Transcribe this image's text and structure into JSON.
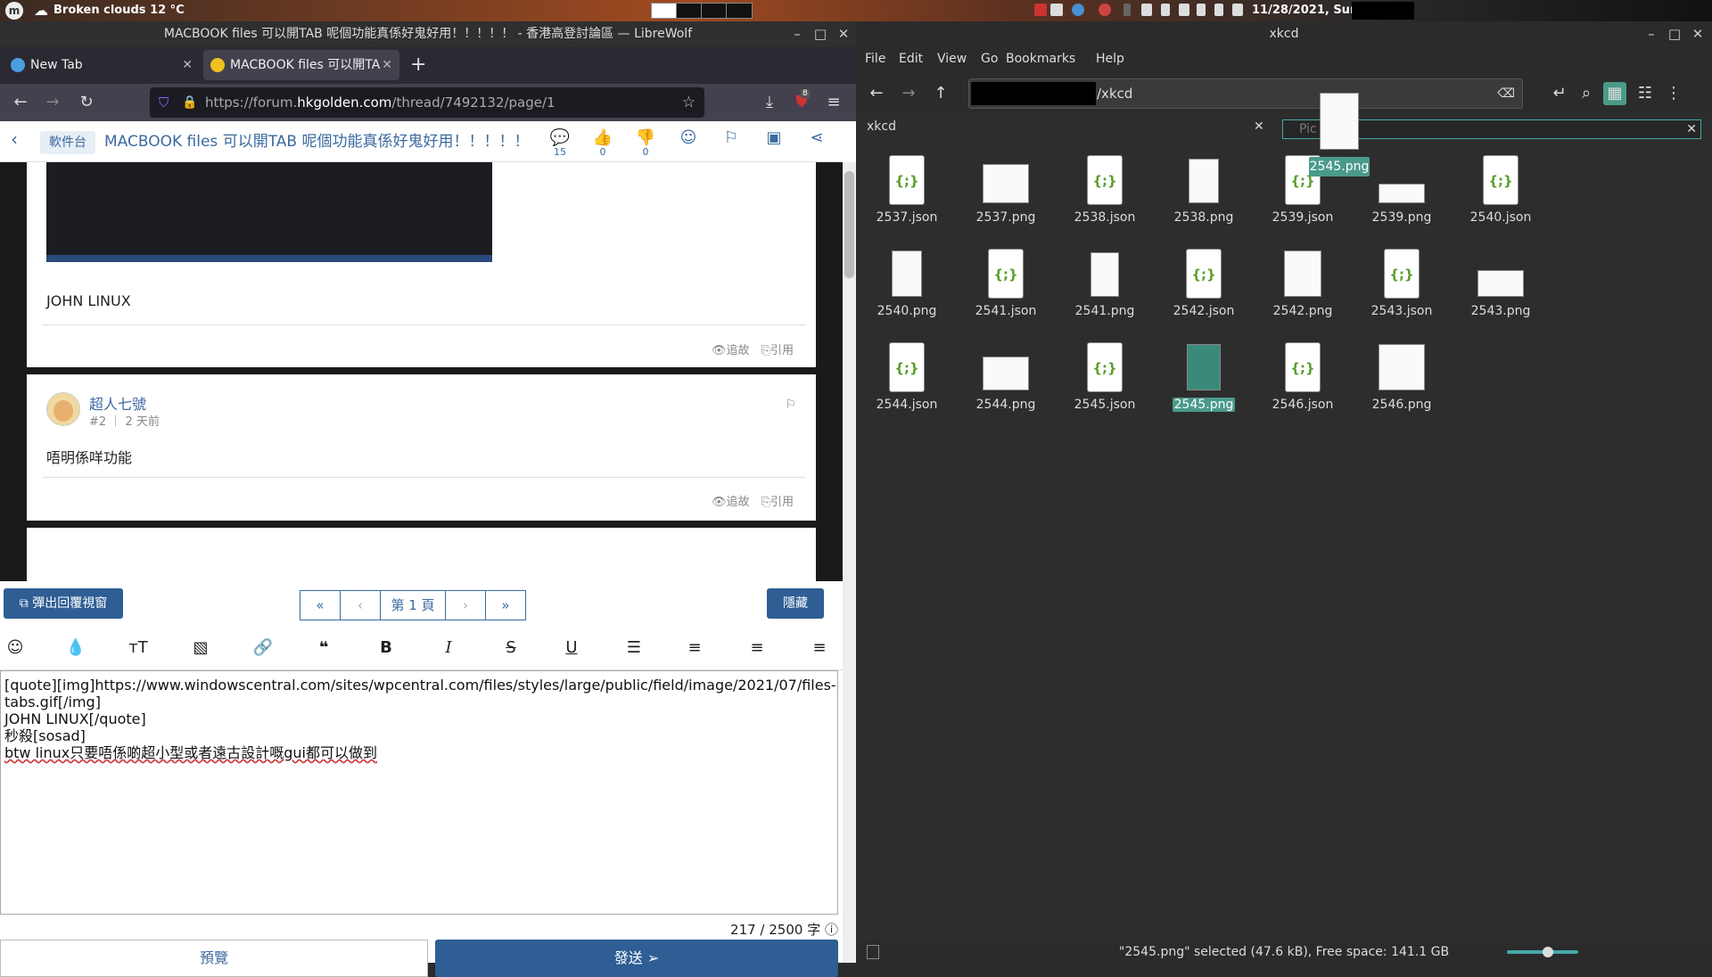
{
  "panel": {
    "weather": "Broken clouds 12 °C",
    "datetime": "11/28/2021, Sunday"
  },
  "browser": {
    "window_title": "MACBOOK files 可以開TAB 呢個功能真係好鬼好用！！！！！ - 香港高登討論區 — LibreWolf",
    "tabs": [
      {
        "label": "New Tab"
      },
      {
        "label": "MACBOOK files 可以開TA"
      }
    ],
    "url_prefix": "https://forum.",
    "url_domain": "hkgolden.com",
    "url_suffix": "/thread/7492132/page/1",
    "badge_count": "8"
  },
  "thread": {
    "category": "軟件台",
    "title": "MACBOOK files 可以開TAB 呢個功能真係好鬼好用！！！！！",
    "reply_count": "15",
    "like_count": "0",
    "dislike_count": "0"
  },
  "posts": [
    {
      "text": "JOHN LINUX",
      "follow": "追故",
      "quote": "引用"
    },
    {
      "username": "超人七號",
      "number": "#2",
      "time": "2 天前",
      "text": "唔明係咩功能",
      "follow": "追故",
      "quote": "引用"
    }
  ],
  "pager": {
    "popup_button": "彈出回覆視窗",
    "page_label": "第 1 頁",
    "hide_button": "隱藏"
  },
  "editor": {
    "lines": [
      "[quote][img]https://www.windowscentral.com/sites/wpcentral.com/files/styles/large/public/field/image/2021/07/files-",
      "tabs.gif[/img]",
      "JOHN LINUX[/quote]",
      "秒殺[sosad]",
      "btw linux只要唔係啲超小型或者遠古設計嘅gui都可以做到"
    ],
    "char_count": "217 / 2500 字",
    "preview_button": "預覽",
    "send_button": "發送"
  },
  "filemanager": {
    "window_title": "xkcd",
    "menu": [
      "File",
      "Edit",
      "View",
      "Go",
      "Bookmarks",
      "Help"
    ],
    "path": "/xkcd",
    "tab_label": "xkcd",
    "search_placeholder": "Pic",
    "files": [
      {
        "name": "2537.json",
        "kind": "json"
      },
      {
        "name": "2537.png",
        "kind": "png"
      },
      {
        "name": "2538.json",
        "kind": "json"
      },
      {
        "name": "2538.png",
        "kind": "png"
      },
      {
        "name": "2539.json",
        "kind": "json"
      },
      {
        "name": "2539.png",
        "kind": "png"
      },
      {
        "name": "2540.json",
        "kind": "json"
      },
      {
        "name": "2540.png",
        "kind": "png"
      },
      {
        "name": "2541.json",
        "kind": "json"
      },
      {
        "name": "2541.png",
        "kind": "png"
      },
      {
        "name": "2542.json",
        "kind": "json"
      },
      {
        "name": "2542.png",
        "kind": "png"
      },
      {
        "name": "2543.json",
        "kind": "json"
      },
      {
        "name": "2543.png",
        "kind": "png"
      },
      {
        "name": "2544.json",
        "kind": "json"
      },
      {
        "name": "2544.png",
        "kind": "png"
      },
      {
        "name": "2545.json",
        "kind": "json"
      },
      {
        "name": "2545.png",
        "kind": "png",
        "selected": true
      },
      {
        "name": "2546.json",
        "kind": "json"
      },
      {
        "name": "2546.png",
        "kind": "png"
      }
    ],
    "drag_label": "2545.png",
    "status": "\"2545.png\" selected (47.6 kB), Free space: 141.1 GB",
    "json_glyph": "{;}"
  }
}
